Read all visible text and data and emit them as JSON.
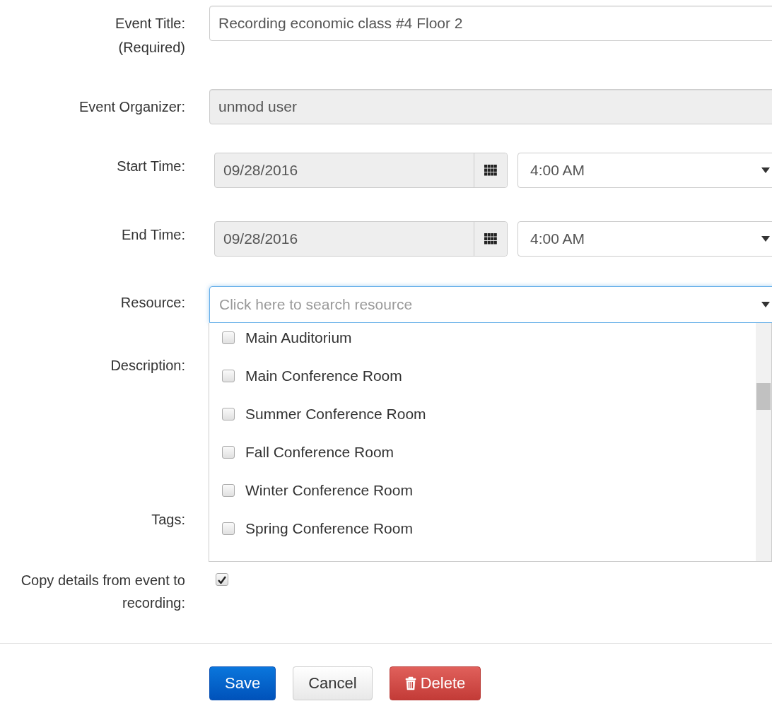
{
  "event_title": {
    "label": "Event Title:",
    "note": "(Required)",
    "value": "Recording economic class #4 Floor 2"
  },
  "organizer": {
    "label": "Event Organizer:",
    "value": "unmod user",
    "disabled": true
  },
  "start_time": {
    "label": "Start Time:",
    "date": "09/28/2016",
    "time": "4:00 AM"
  },
  "end_time": {
    "label": "End Time:",
    "date": "09/28/2016",
    "time": "4:00 AM"
  },
  "resource": {
    "label": "Resource:",
    "placeholder": "Click here to search resource",
    "expanded": true,
    "options": [
      {
        "label": "Main Auditorium",
        "checked": false
      },
      {
        "label": "Main Conference Room",
        "checked": false
      },
      {
        "label": "Summer Conference Room",
        "checked": false
      },
      {
        "label": "Fall Conference Room",
        "checked": false
      },
      {
        "label": "Winter Conference Room",
        "checked": false
      },
      {
        "label": "Spring Conference Room",
        "checked": false
      }
    ]
  },
  "description": {
    "label": "Description:"
  },
  "tags": {
    "label": "Tags:"
  },
  "copy_details": {
    "label": "Copy details from event to recording:",
    "checked": true
  },
  "buttons": [
    {
      "label": "Save",
      "kind": "primary"
    },
    {
      "label": "Cancel",
      "kind": "default"
    },
    {
      "label": "Delete",
      "kind": "danger"
    }
  ]
}
